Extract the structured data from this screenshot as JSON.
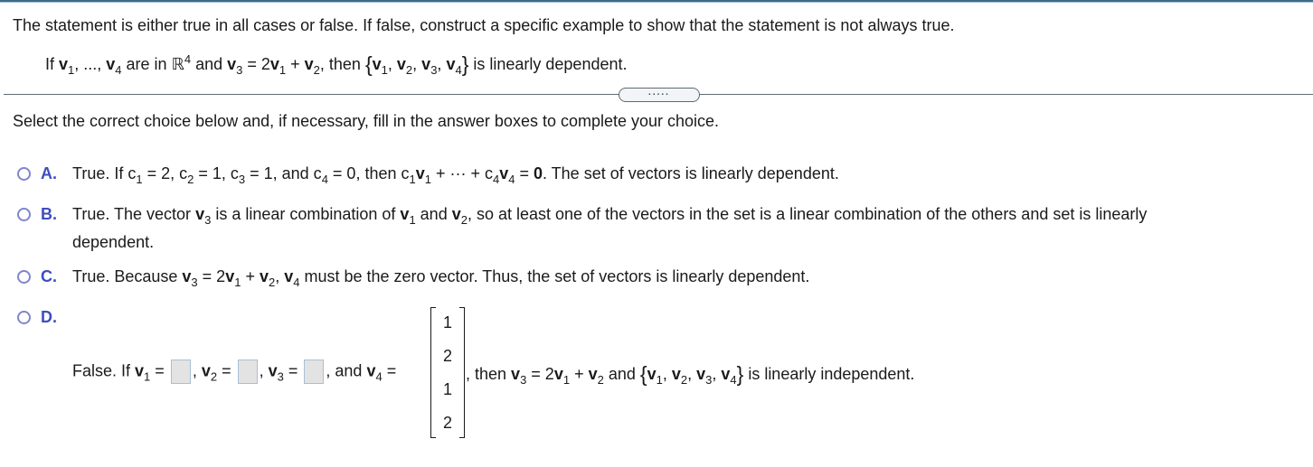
{
  "instructions": "The statement is either true in all cases or false. If false, construct a specific example to show that the statement is not always true.",
  "statement": {
    "p1": "If ",
    "v1": "v",
    "s1": "1",
    "p2": ", ..., ",
    "v4": "v",
    "s4": "4",
    "p3": " are in ",
    "R": "ℝ",
    "Rexp": "4",
    "p4": " and ",
    "v3": "v",
    "s3": "3",
    "p5": " = 2",
    "v1b": "v",
    "s1b": "1",
    "p6": " + ",
    "v2": "v",
    "s2": "2",
    "p7": ", then ",
    "lbrace": "{",
    "set": [
      "v",
      "1",
      ", ",
      "v",
      "2",
      ", ",
      "v",
      "3",
      ", ",
      "v",
      "4"
    ],
    "rbrace": "}",
    "p8": " is linearly dependent."
  },
  "expander_label": ".....",
  "select_prompt": "Select the correct choice below and, if necessary, fill in the answer boxes to complete your choice.",
  "choices": {
    "A": {
      "letter": "A.",
      "t1": "True. If c",
      "s1": "1",
      "t2": " = 2, c",
      "s2": "2",
      "t3": " = 1, c",
      "s3": "3",
      "t4": " = 1, and c",
      "s4": "4",
      "t5": " = 0, then c",
      "s5": "1",
      "v1": "v",
      "s6": "1",
      "t6": " + ··· + c",
      "s7": "4",
      "v4": "v",
      "s8": "4",
      "t7": " = ",
      "zero": "0",
      "t8": ". The set of vectors is linearly dependent."
    },
    "B": {
      "letter": "B.",
      "t1": "True. The vector ",
      "v3": "v",
      "s3": "3",
      "t2": " is a linear combination of ",
      "v1": "v",
      "s1": "1",
      "t3": " and ",
      "v2": "v",
      "s2": "2",
      "t4": ", so at least one of the vectors in the set is a linear combination of the others and set is linearly",
      "line2": "dependent."
    },
    "C": {
      "letter": "C.",
      "t1": "True. Because ",
      "v3": "v",
      "s3": "3",
      "t2": " = 2",
      "v1": "v",
      "s1": "1",
      "t3": " + ",
      "v2": "v",
      "s2": "2",
      "t4": ", ",
      "v4": "v",
      "s4": "4",
      "t5": " must be the zero vector. Thus, the set of vectors is linearly dependent."
    },
    "D": {
      "letter": "D.",
      "t1": "False. If ",
      "v1": "v",
      "s1": "1",
      "eq": " =",
      "t2": ", ",
      "v2": "v",
      "s2": "2",
      "t3": ", ",
      "v3": "v",
      "s3": "3",
      "t4": ", and ",
      "v4": "v",
      "s4": "4",
      "v4_entries": [
        "1",
        "2",
        "1",
        "2"
      ],
      "after1": ", then ",
      "av3": "v",
      "as3": "3",
      "after2": " = 2",
      "av1": "v",
      "as1": "1",
      "after3": " + ",
      "av2": "v",
      "as2": "2",
      "after4": " and ",
      "lbrace": "{",
      "set": [
        "v",
        "1",
        ", ",
        "v",
        "2",
        ", ",
        "v",
        "3",
        ", ",
        "v",
        "4"
      ],
      "rbrace": "}",
      "after5": " is linearly independent.",
      "answer_boxes": [
        "",
        "",
        ""
      ]
    }
  }
}
